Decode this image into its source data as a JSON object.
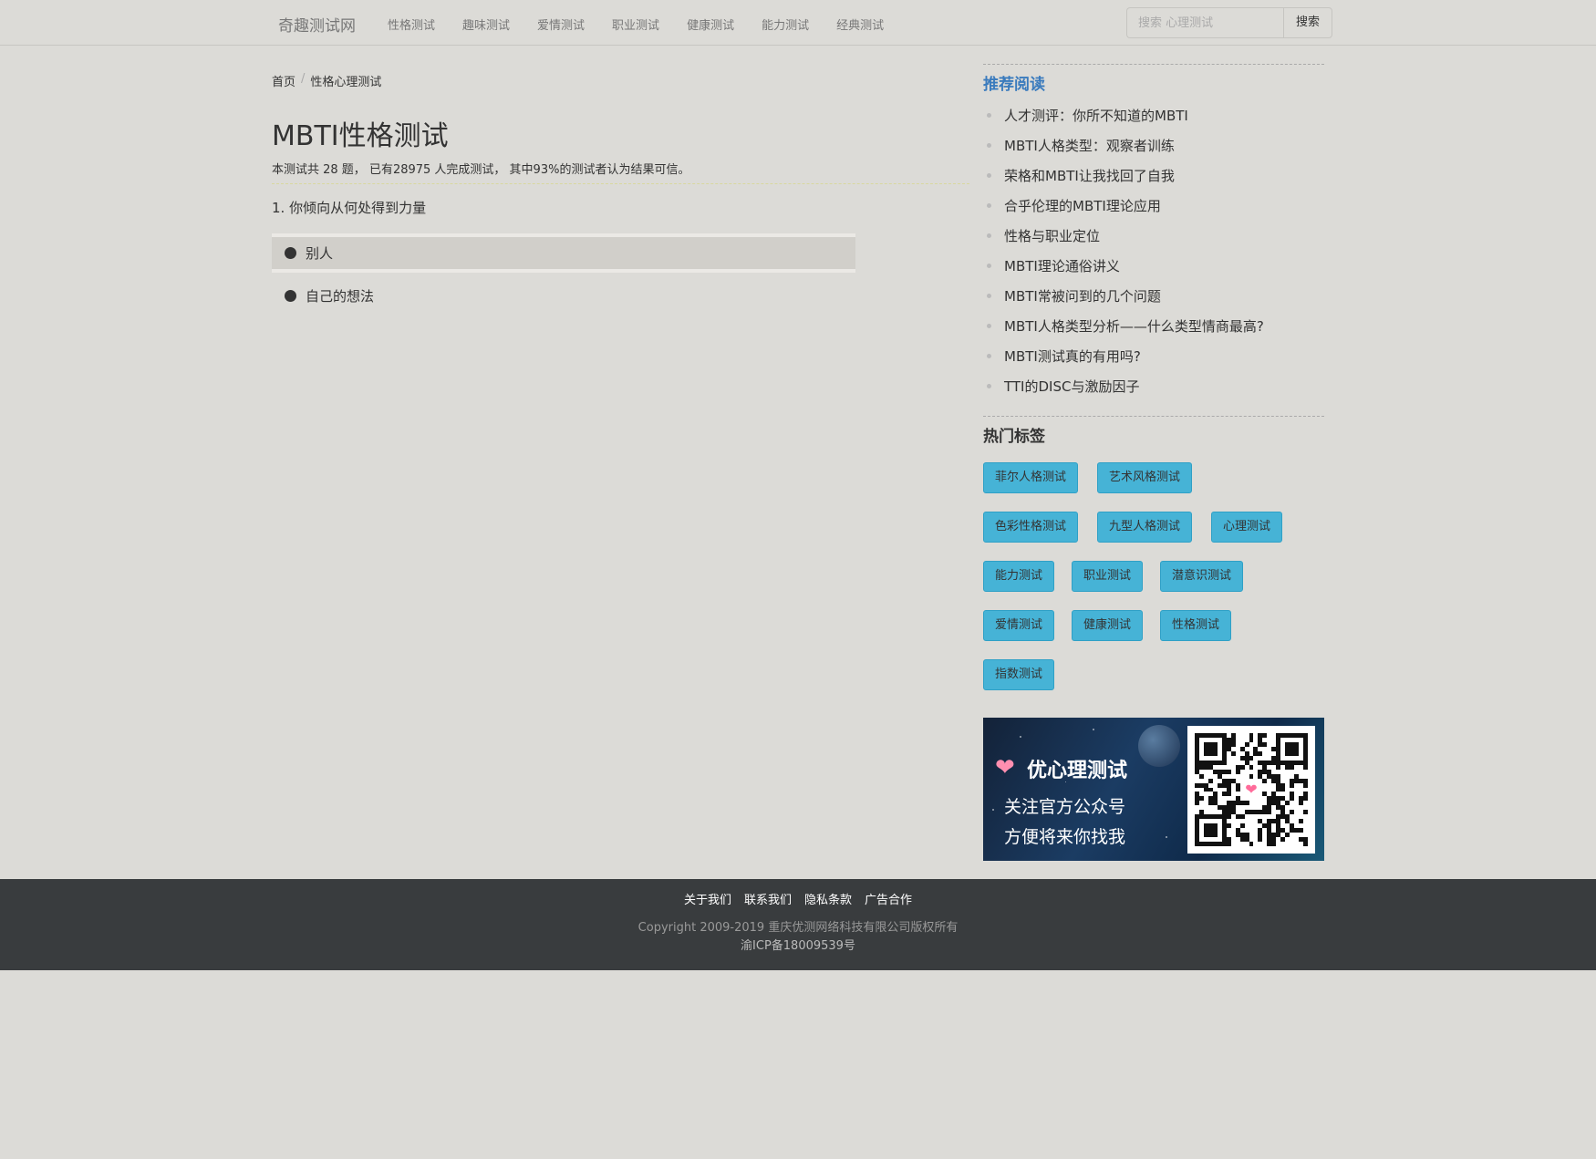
{
  "nav": {
    "brand": "奇趣测试网",
    "items": [
      "性格测试",
      "趣味测试",
      "爱情测试",
      "职业测试",
      "健康测试",
      "能力测试",
      "经典测试"
    ],
    "search_placeholder": "搜索 心理测试",
    "search_button": "搜索"
  },
  "breadcrumb": {
    "home": "首页",
    "sep": "/",
    "current": "性格心理测试"
  },
  "test": {
    "title": "MBTI性格测试",
    "info": "本测试共 28 题， 已有28975 人完成测试， 其中93%的测试者认为结果可信。",
    "question": "1. 你倾向从何处得到力量",
    "options": [
      "别人",
      "自己的想法"
    ],
    "selected_option": "别人"
  },
  "sidebar": {
    "recommended_title": "推荐阅读",
    "recommended": [
      "人才测评：你所不知道的MBTI",
      "MBTI人格类型：观察者训练",
      "荣格和MBTI让我找回了自我",
      "合乎伦理的MBTI理论应用",
      "性格与职业定位",
      "MBTI理论通俗讲义",
      "MBTI常被问到的几个问题",
      "MBTI人格类型分析——什么类型情商最高?",
      "MBTI测试真的有用吗?",
      "TTI的DISC与激励因子"
    ],
    "tags_title": "热门标签",
    "tags": [
      "菲尔人格测试",
      "艺术风格测试",
      "色彩性格测试",
      "九型人格测试",
      "心理测试",
      "能力测试",
      "职业测试",
      "潜意识测试",
      "爱情测试",
      "健康测试",
      "性格测试",
      "指数测试"
    ],
    "banner": {
      "name": "优心理测试",
      "line1": "关注官方公众号",
      "line2": "方便将来你找我"
    }
  },
  "footer": {
    "links": [
      "关于我们",
      "联系我们",
      "隐私条款",
      "广告合作"
    ],
    "copyright": "Copyright 2009-2019 重庆优测网络科技有限公司版权所有",
    "icp": "渝ICP备18009539号"
  },
  "colors": {
    "background": "#dcdbd7",
    "accent_blue": "#3a7bbd",
    "tag_bg": "#46b3d6",
    "footer_bg": "#393c3e"
  }
}
